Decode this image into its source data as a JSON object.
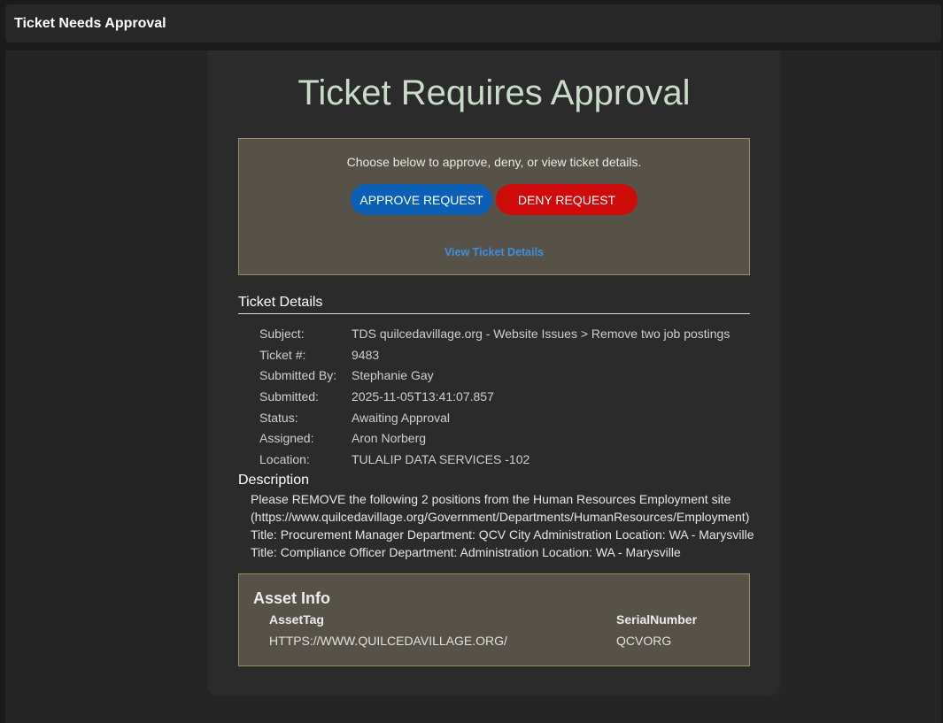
{
  "window": {
    "title": "Ticket Needs Approval"
  },
  "page": {
    "heading": "Ticket Requires Approval"
  },
  "approval": {
    "prompt": "Choose below to approve, deny, or view ticket details.",
    "approve_label": "APPROVE REQUEST",
    "deny_label": "DENY REQUEST",
    "view_link": "View Ticket Details"
  },
  "details": {
    "title": "Ticket Details",
    "rows": [
      {
        "label": "Subject:",
        "value": "TDS quilcedavillage.org - Website Issues > Remove two job postings"
      },
      {
        "label": "Ticket #:",
        "value": "9483"
      },
      {
        "label": "Submitted By:",
        "value": "Stephanie Gay"
      },
      {
        "label": "Submitted:",
        "value": "2025-11-05T13:41:07.857"
      },
      {
        "label": "Status:",
        "value": "Awaiting Approval"
      },
      {
        "label": "Assigned:",
        "value": "Aron Norberg"
      },
      {
        "label": "Location:",
        "value": "TULALIP DATA SERVICES -102"
      }
    ]
  },
  "description": {
    "title": "Description",
    "text": "Please REMOVE the following 2 positions from the Human Resources Employment site (https://www.quilcedavillage.org/Government/Departments/HumanResources/Employment) Title: Procurement Manager Department: QCV City Administration Location: WA - Marysville Title: Compliance Officer Department: Administration Location: WA - Marysville"
  },
  "asset": {
    "title": "Asset Info",
    "headers": [
      "AssetTag",
      "SerialNumber"
    ],
    "rows": [
      [
        "HTTPS://WWW.QUILCEDAVILLAGE.ORG/",
        "QCVORG"
      ]
    ]
  },
  "colors": {
    "approve": "#0b5fb4",
    "deny": "#cf0a0a",
    "link": "#3b8fe0",
    "heading": "#c8dcc8",
    "panel": "#575247"
  }
}
